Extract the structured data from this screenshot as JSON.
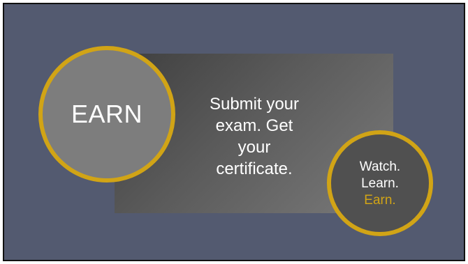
{
  "colors": {
    "background": "#535a70",
    "accent": "#d1a416",
    "earn_circle_fill": "#7d7d7d",
    "tagline_circle_fill": "#505050"
  },
  "earn_badge": {
    "label": "EARN"
  },
  "message": {
    "lines": [
      "Submit your",
      "exam. Get",
      "your",
      "certificate."
    ]
  },
  "tagline": {
    "lines": [
      "Watch.",
      "Learn.",
      "Earn."
    ]
  }
}
